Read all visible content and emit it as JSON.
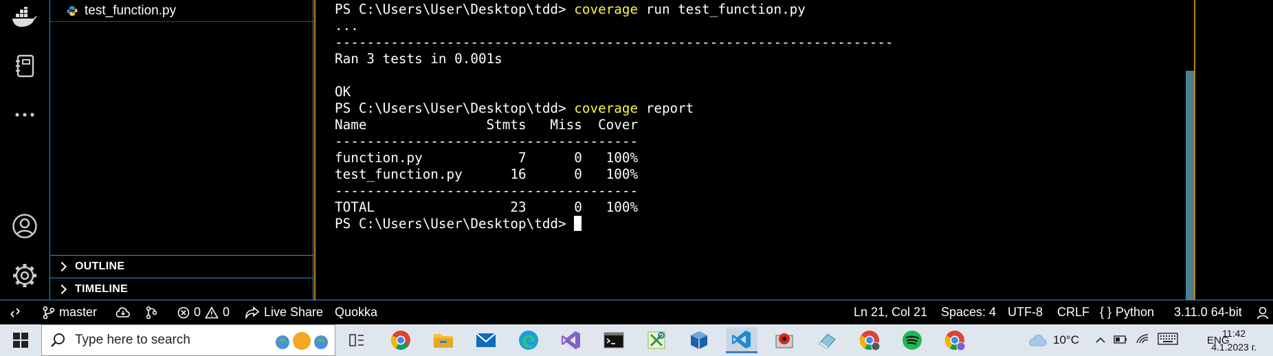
{
  "explorer": {
    "file_name": "test_function.py",
    "outline_label": "OUTLINE",
    "timeline_label": "TIMELINE"
  },
  "terminal": {
    "prompt": "PS C:\\Users\\User\\Desktop\\tdd>",
    "cmd1_keyword": "coverage",
    "cmd1_args": "run test_function.py",
    "dots": "...",
    "separator1": "----------------------------------------------------------------------",
    "ran_line": "Ran 3 tests in 0.001s",
    "ok_line": "OK",
    "cmd2_keyword": "coverage",
    "cmd2_args": "report",
    "report_header": "Name               Stmts   Miss  Cover",
    "report_separator": "--------------------------------------",
    "report_rows": [
      "function.py            7      0   100%",
      "test_function.py      16      0   100%"
    ],
    "report_total": "TOTAL                 23      0   100%"
  },
  "status_bar": {
    "branch": "master",
    "errors": "0",
    "warnings": "0",
    "live_share": "Live Share",
    "quokka": "Quokka",
    "position": "Ln 21, Col 21",
    "spaces": "Spaces: 4",
    "encoding": "UTF-8",
    "eol": "CRLF",
    "language": "Python",
    "interpreter": "3.11.0 64-bit"
  },
  "taskbar": {
    "search_placeholder": "Type here to search",
    "temperature": "10°C",
    "language": "ENG",
    "time": "11:42",
    "date": "4.1.2023 г."
  },
  "colors": {
    "keyword": "#f5f543",
    "accent_border": "#2a93d5",
    "terminal_border": "#b8860b",
    "scrollbar": "#4a7f8f"
  }
}
